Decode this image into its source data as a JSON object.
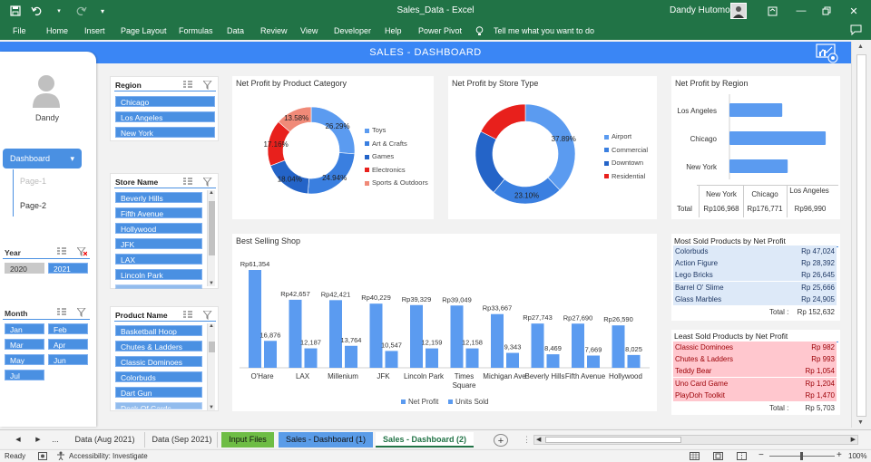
{
  "window": {
    "doc_title": "Sales_Data  -  Excel",
    "user_name": "Dandy Hutomo"
  },
  "ribbon": {
    "tabs": [
      "File",
      "Home",
      "Insert",
      "Page Layout",
      "Formulas",
      "Data",
      "Review",
      "View",
      "Developer",
      "Help",
      "Power Pivot"
    ],
    "tell_me": "Tell me what you want to do"
  },
  "banner": {
    "title": "SALES - DASHBOARD"
  },
  "left_panel": {
    "user": "Dandy",
    "nav_active": "Dashboard",
    "nav_items": [
      "Page-1",
      "Page-2"
    ]
  },
  "year_slicer": {
    "title": "Year",
    "items": [
      "2020",
      "2021"
    ]
  },
  "month_slicer": {
    "title": "Month",
    "items": [
      "Jan",
      "Feb",
      "Mar",
      "Apr",
      "May",
      "Jun",
      "Jul"
    ]
  },
  "region_slicer": {
    "title": "Region",
    "items": [
      "Chicago",
      "Los Angeles",
      "New York"
    ]
  },
  "store_slicer": {
    "title": "Store Name",
    "items": [
      "Beverly Hills",
      "Fifth Avenue",
      "Hollywood",
      "JFK",
      "LAX",
      "Lincoln Park",
      "Michigan Ave"
    ]
  },
  "product_slicer": {
    "title": "Product Name",
    "items": [
      "Basketball Hoop",
      "Chutes & Ladders",
      "Classic Dominoes",
      "Colorbuds",
      "Dart Gun",
      "Deck Of Cards"
    ]
  },
  "chart_data": [
    {
      "type": "pie",
      "title": "Net Profit by Product Category",
      "categories": [
        "Toys",
        "Art & Crafts",
        "Games",
        "Electronics",
        "Sports & Outdoors"
      ],
      "values": [
        26.29,
        24.94,
        18.04,
        17.16,
        13.58
      ],
      "labels": [
        "26.29%",
        "24.94%",
        "18.04%",
        "17.16%",
        "13.58%"
      ],
      "colors": [
        "#5b9bf0",
        "#3a7fe0",
        "#2464c8",
        "#e8201c",
        "#f08a78"
      ]
    },
    {
      "type": "pie",
      "title": "Net Profit by Store Type",
      "categories": [
        "Airport",
        "Commercial",
        "Downtown",
        "Residential"
      ],
      "values": [
        37.89,
        23.1,
        21.48,
        17.53
      ],
      "labels": [
        "37.89%",
        "23.10%",
        "",
        "",
        ""
      ],
      "colors": [
        "#5b9bf0",
        "#3a7fe0",
        "#2464c8",
        "#e8201c"
      ]
    },
    {
      "type": "bar",
      "title": "Net Profit by Region",
      "categories": [
        "Los Angeles",
        "Chicago",
        "New York"
      ],
      "values": [
        96990,
        176771,
        106968
      ],
      "xlim": [
        0,
        180000
      ]
    },
    {
      "type": "bar",
      "title": "Best Selling Shop",
      "categories": [
        "O'Hare",
        "LAX",
        "Millenium",
        "JFK",
        "Lincoln Park",
        "Times Square",
        "Michigan Ave",
        "Beverly Hills",
        "Fifth Avenue",
        "Hollywood"
      ],
      "series": [
        {
          "name": "Net Profit",
          "values": [
            61354,
            42657,
            42421,
            40229,
            39329,
            39049,
            33667,
            27743,
            27690,
            26590
          ],
          "labels": [
            "Rp61,354",
            "Rp42,657",
            "Rp42,421",
            "Rp40,229",
            "Rp39,329",
            "Rp39,049",
            "Rp33,667",
            "Rp27,743",
            "Rp27,690",
            "Rp26,590"
          ]
        },
        {
          "name": "Units Sold",
          "values": [
            16876,
            12187,
            13764,
            10547,
            12159,
            12158,
            9343,
            8469,
            7669,
            8025
          ],
          "labels": [
            "16,876",
            "12,187",
            "13,764",
            "10,547",
            "12,159",
            "12,158",
            "9,343",
            "8,469",
            "7,669",
            "8,025"
          ]
        }
      ],
      "ylim": [
        0,
        65000
      ]
    }
  ],
  "region_table": {
    "headers": [
      "New York",
      "Chicago",
      "Los Angeles"
    ],
    "row_label": "Total",
    "values": [
      "Rp106,968",
      "Rp176,771",
      "Rp96,990"
    ]
  },
  "most_sold": {
    "title": "Most Sold Products by Net Profit",
    "rows": [
      {
        "name": "Colorbuds",
        "value": "Rp 47,024"
      },
      {
        "name": "Action Figure",
        "value": "Rp 28,392"
      },
      {
        "name": "Lego Bricks",
        "value": "Rp 26,645"
      },
      {
        "name": "Barrel O' Slime",
        "value": "Rp 25,666"
      },
      {
        "name": "Glass Marbles",
        "value": "Rp 24,905"
      }
    ],
    "total_label": "Total :",
    "total_value": "Rp 152,632"
  },
  "least_sold": {
    "title": "Least Sold Products by Net Profit",
    "rows": [
      {
        "name": "Classic Dominoes",
        "value": "Rp 982"
      },
      {
        "name": "Chutes & Ladders",
        "value": "Rp 993"
      },
      {
        "name": "Teddy Bear",
        "value": "Rp 1,054"
      },
      {
        "name": "Uno Card Game",
        "value": "Rp 1,204"
      },
      {
        "name": "PlayDoh Toolkit",
        "value": "Rp 1,470"
      }
    ],
    "total_label": "Total :",
    "total_value": "Rp 5,703"
  },
  "sheet_tabs": [
    "...",
    "Data (Aug 2021)",
    "Data (Sep 2021)",
    "Input Files",
    "Sales - Dashboard (1)",
    "Sales - Dashboard (2)"
  ],
  "status": {
    "ready": "Ready",
    "accessibility": "Accessibility: Investigate",
    "zoom": "100%"
  },
  "colors": {
    "excel_green": "#217346",
    "banner_blue": "#3a86f5",
    "slicer_blue": "#4a90e2",
    "least_row_pink": "#ffc7ce",
    "most_row_blue": "#dde9f8"
  }
}
